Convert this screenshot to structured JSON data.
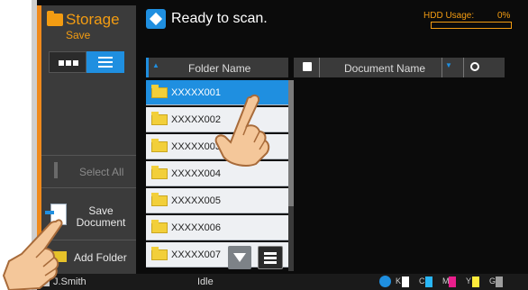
{
  "app": {
    "title": "Storage",
    "subtitle": "Save"
  },
  "status": {
    "text": "Ready to scan.",
    "hdd_label": "HDD Usage:",
    "hdd_percent": "0%",
    "hdd_fraction": 0
  },
  "sidebar": {
    "select_all": "Select All",
    "save_document": "Save Document",
    "add_folder": "Add Folder",
    "view_mode": "list"
  },
  "columns": {
    "folder_name": "Folder Name",
    "document_name": "Document Name"
  },
  "folders": [
    {
      "name": "XXXXX001",
      "selected": true
    },
    {
      "name": "XXXXX002",
      "selected": false
    },
    {
      "name": "XXXXX003",
      "selected": false
    },
    {
      "name": "XXXXX004",
      "selected": false
    },
    {
      "name": "XXXXX005",
      "selected": false
    },
    {
      "name": "XXXXX006",
      "selected": false
    },
    {
      "name": "XXXXX007",
      "selected": false
    }
  ],
  "footer": {
    "user": "J.Smith",
    "state": "Idle",
    "toners": [
      {
        "label": "K",
        "color": "#ffffff"
      },
      {
        "label": "C",
        "color": "#29b6f6"
      },
      {
        "label": "M",
        "color": "#e91e8c"
      },
      {
        "label": "Y",
        "color": "#ffeb3b"
      },
      {
        "label": "G",
        "color": "#9e9e9e"
      }
    ]
  },
  "colors": {
    "accent": "#1f8fe0",
    "brand": "#f39c12"
  }
}
